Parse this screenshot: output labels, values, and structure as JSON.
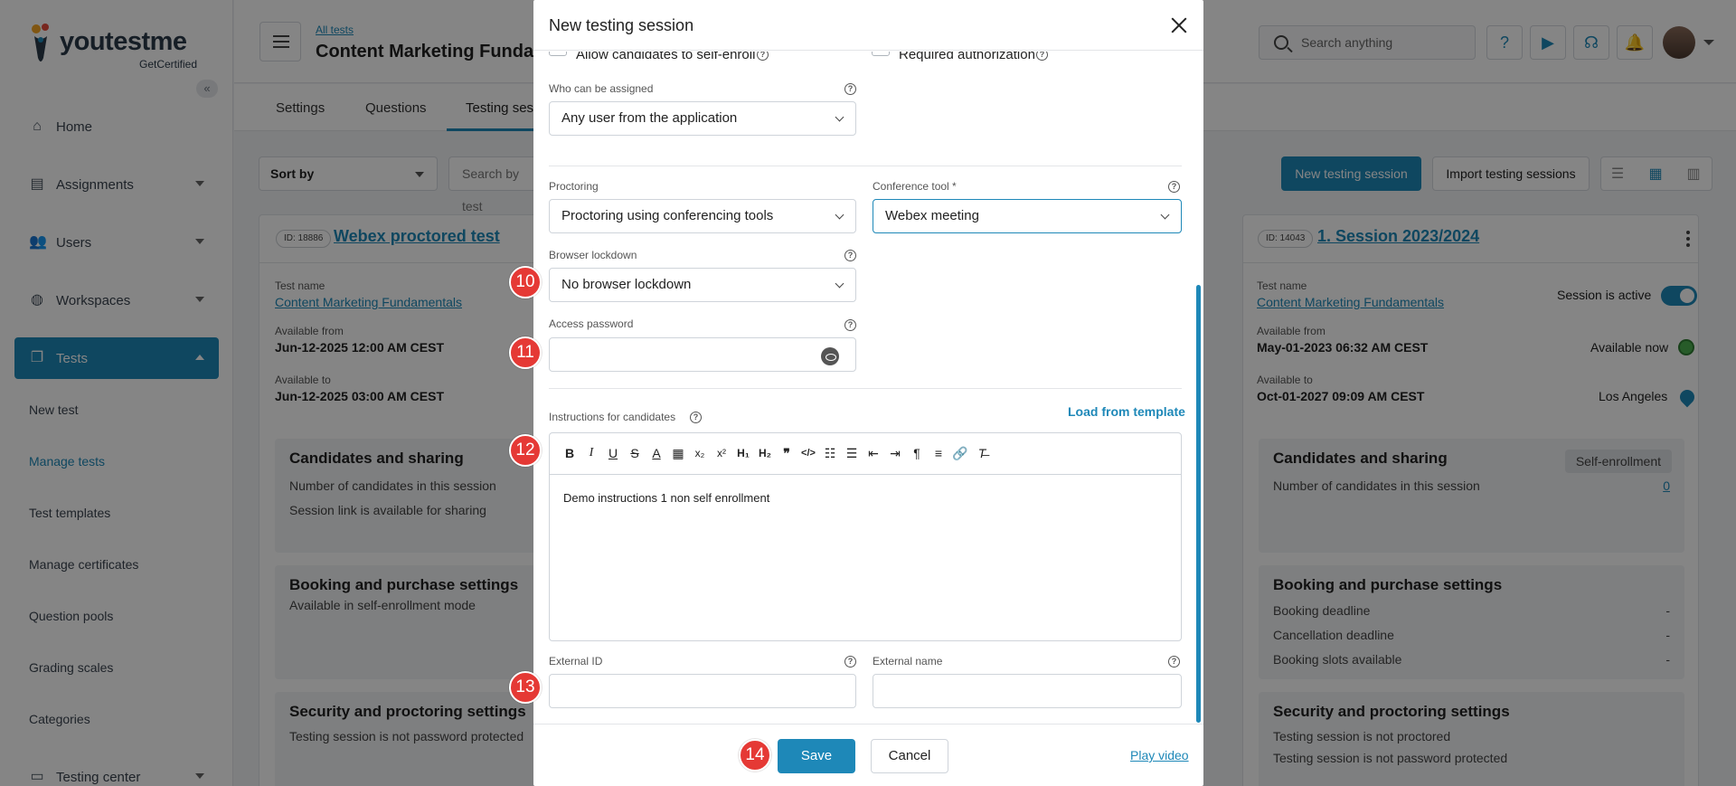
{
  "colors": {
    "accent": "#1e88b8",
    "marker": "#e53935",
    "success": "#4caf50"
  },
  "brand": {
    "name": "youtestme",
    "sub": "GetCertified"
  },
  "sidebar": {
    "collapse_icon": "double-chevron-left-icon",
    "items": [
      {
        "label": "Home",
        "icon": "home-icon"
      },
      {
        "label": "Assignments",
        "icon": "assignments-icon"
      },
      {
        "label": "Users",
        "icon": "users-icon"
      },
      {
        "label": "Workspaces",
        "icon": "globe-icon"
      },
      {
        "label": "Tests",
        "icon": "tests-icon"
      }
    ],
    "sub_items": [
      "New test",
      "Manage tests",
      "Test templates",
      "Manage certificates",
      "Question pools",
      "Grading scales",
      "Categories"
    ],
    "testing_center": "Testing center"
  },
  "header": {
    "breadcrumb": "All tests",
    "title": "Content Marketing Fundamentals",
    "search_placeholder": "Search anything"
  },
  "tabs": [
    "Settings",
    "Questions",
    "Testing sessions"
  ],
  "toolbar": {
    "sort_label": "Sort by",
    "search_placeholder": "Search by test",
    "new_session": "New testing session",
    "import_sessions": "Import testing sessions"
  },
  "left_card": {
    "id": "ID: 18886",
    "title": "Webex proctored test",
    "test_name_label": "Test name",
    "test_name": "Content Marketing Fundamentals",
    "from_label": "Available from",
    "from_value": "Jun-12-2025 12:00 AM CEST",
    "to_label": "Available to",
    "to_value": "Jun-12-2025 03:00 AM CEST",
    "cand_title": "Candidates and sharing",
    "cand_line1": "Number of candidates in this session",
    "cand_line2": "Session link is available for sharing",
    "booking_title": "Booking and purchase settings",
    "booking_line": "Available in self-enrollment mode",
    "security_title": "Security and proctoring settings",
    "security_line": "Testing session is not password protected"
  },
  "right_card": {
    "id": "ID: 14043",
    "title": "1. Session 2023/2024",
    "test_name_label": "Test name",
    "test_name": "Content Marketing Fundamentals",
    "active_label": "Session is active",
    "from_label": "Available from",
    "from_value": "May-01-2023 06:32 AM CEST",
    "available_now": "Available now",
    "to_label": "Available to",
    "to_value": "Oct-01-2027 09:09 AM CEST",
    "location": "Los Angeles",
    "cand_title": "Candidates and sharing",
    "cand_badge": "Self-enrollment",
    "cand_line1": "Number of candidates in this session",
    "cand_count": "0",
    "booking_title": "Booking and purchase settings",
    "booking_rows": [
      {
        "label": "Booking deadline",
        "value": "-"
      },
      {
        "label": "Cancellation deadline",
        "value": "-"
      },
      {
        "label": "Booking slots available",
        "value": "-"
      }
    ],
    "security_title": "Security and proctoring settings",
    "security_line1": "Testing session is not proctored",
    "security_line2": "Testing session is not password protected"
  },
  "modal": {
    "title": "New testing session",
    "allow_self_enroll": "Allow candidates to self-enroll",
    "required_authorization": "Required authorization",
    "who_label": "Who can be assigned",
    "who_value": "Any user from the application",
    "proctoring_label": "Proctoring",
    "proctoring_value": "Proctoring using conferencing tools",
    "conference_label": "Conference tool *",
    "conference_value": "Webex meeting",
    "lockdown_label": "Browser lockdown",
    "lockdown_value": "No browser lockdown",
    "password_label": "Access password",
    "password_value": "",
    "instructions_label": "Instructions for candidates",
    "load_template": "Load from template",
    "instructions_text": "Demo instructions 1 non self enrollment",
    "external_id_label": "External ID",
    "external_id_value": "",
    "external_name_label": "External name",
    "external_name_value": "",
    "save": "Save",
    "cancel": "Cancel",
    "play_video": "Play video"
  },
  "markers": [
    "10",
    "11",
    "12",
    "13",
    "14"
  ]
}
